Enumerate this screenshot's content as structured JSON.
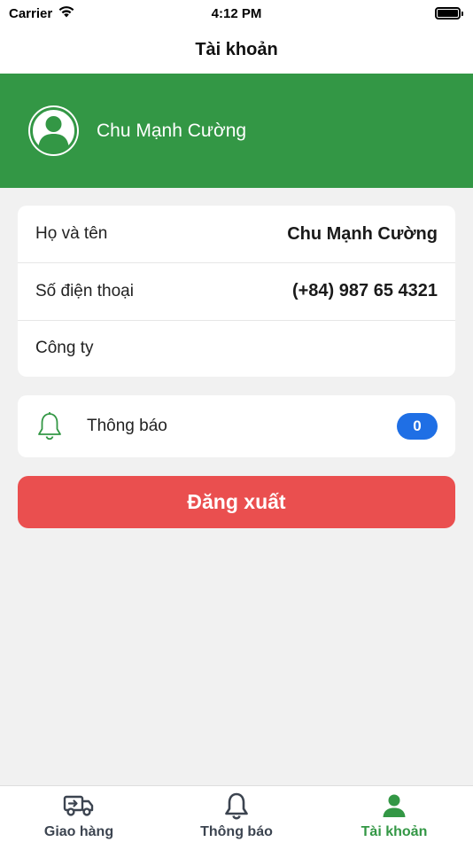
{
  "status_bar": {
    "carrier": "Carrier",
    "time": "4:12 PM"
  },
  "nav": {
    "title": "Tài khoản"
  },
  "profile": {
    "name": "Chu Mạnh Cường"
  },
  "info": [
    {
      "label": "Họ và tên",
      "value": "Chu Mạnh Cường"
    },
    {
      "label": "Số điện thoại",
      "value": "(+84) 987 65 4321"
    },
    {
      "label": "Công ty",
      "value": ""
    }
  ],
  "notifications": {
    "label": "Thông báo",
    "count": "0"
  },
  "logout": {
    "label": "Đăng xuất"
  },
  "tabs": [
    {
      "label": "Giao hàng",
      "icon": "truck-icon"
    },
    {
      "label": "Thông báo",
      "icon": "bell-icon"
    },
    {
      "label": "Tài khoản",
      "icon": "person-icon"
    }
  ],
  "colors": {
    "primary_green": "#339745",
    "logout_red": "#ea4f4f",
    "badge_blue": "#1f6fe5",
    "background": "#f1f1f1"
  }
}
